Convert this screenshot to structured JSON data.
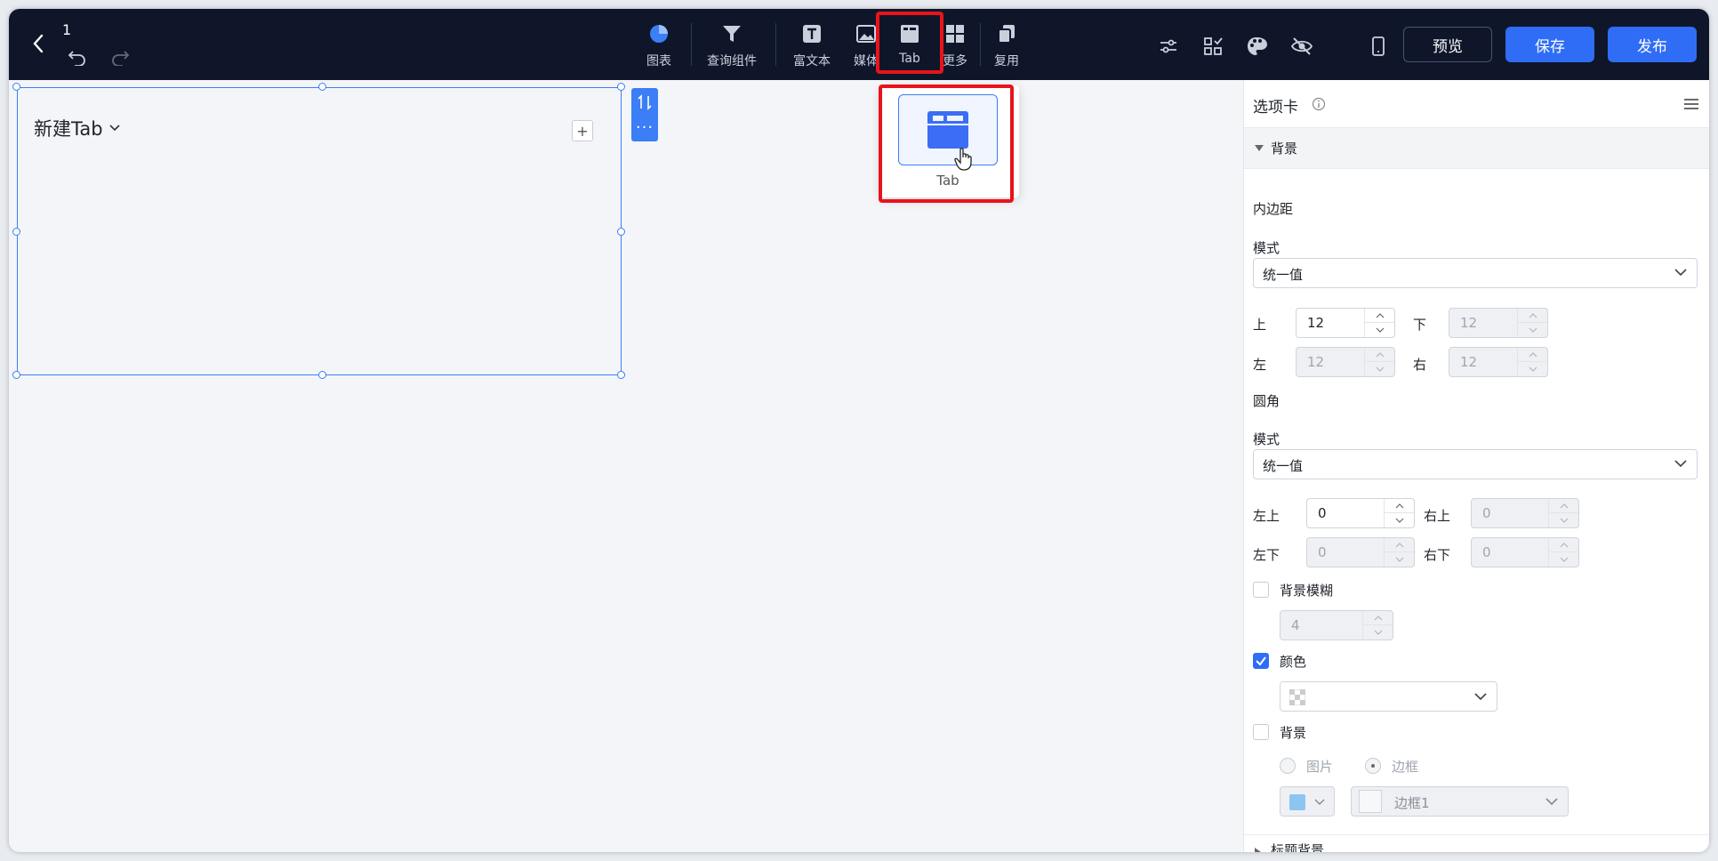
{
  "header": {
    "doc_title": "1",
    "tools": [
      {
        "label": "图表",
        "icon": "pie-chart-icon"
      },
      {
        "label": "查询组件",
        "icon": "filter-icon"
      },
      {
        "label": "富文本",
        "icon": "rich-text-icon"
      },
      {
        "label": "媒体",
        "icon": "image-icon"
      },
      {
        "label": "Tab",
        "icon": "tab-icon"
      },
      {
        "label": "更多",
        "icon": "grid-icon"
      },
      {
        "label": "复用",
        "icon": "copy-icon"
      }
    ],
    "right_icons": [
      "sliders-icon",
      "checklist-icon",
      "palette-icon",
      "eye-off-icon",
      "mobile-icon"
    ],
    "preview_label": "预览",
    "save_label": "保存",
    "publish_label": "发布"
  },
  "canvas": {
    "tab_title": "新建Tab",
    "add_symbol": "+",
    "more_symbol": "···"
  },
  "popover": {
    "item_label": "Tab"
  },
  "panel": {
    "title": "选项卡",
    "section_label": "背景",
    "padding": {
      "label": "内边距",
      "mode_label": "模式",
      "mode_value": "统一值",
      "top_label": "上",
      "top_value": "12",
      "bottom_label": "下",
      "bottom_value": "12",
      "left_label": "左",
      "left_value": "12",
      "right_label": "右",
      "right_value": "12"
    },
    "radius": {
      "label": "圆角",
      "mode_label": "模式",
      "mode_value": "统一值",
      "tl_label": "左上",
      "tl_value": "0",
      "tr_label": "右上",
      "tr_value": "0",
      "bl_label": "左下",
      "bl_value": "0",
      "br_label": "右下",
      "br_value": "0"
    },
    "blur": {
      "label": "背景模糊",
      "checked": false,
      "value": "4"
    },
    "color": {
      "label": "颜色",
      "checked": true
    },
    "background": {
      "label": "背景",
      "checked": false,
      "option_image": "图片",
      "option_border": "边框",
      "selected": "边框",
      "border_value": "边框1",
      "swatch_color": "#8ec5f0"
    },
    "title_bg_label": "标题背景"
  },
  "colors": {
    "accent": "#2f6df6",
    "topbar": "#0f1629",
    "highlight": "#e8141b"
  }
}
